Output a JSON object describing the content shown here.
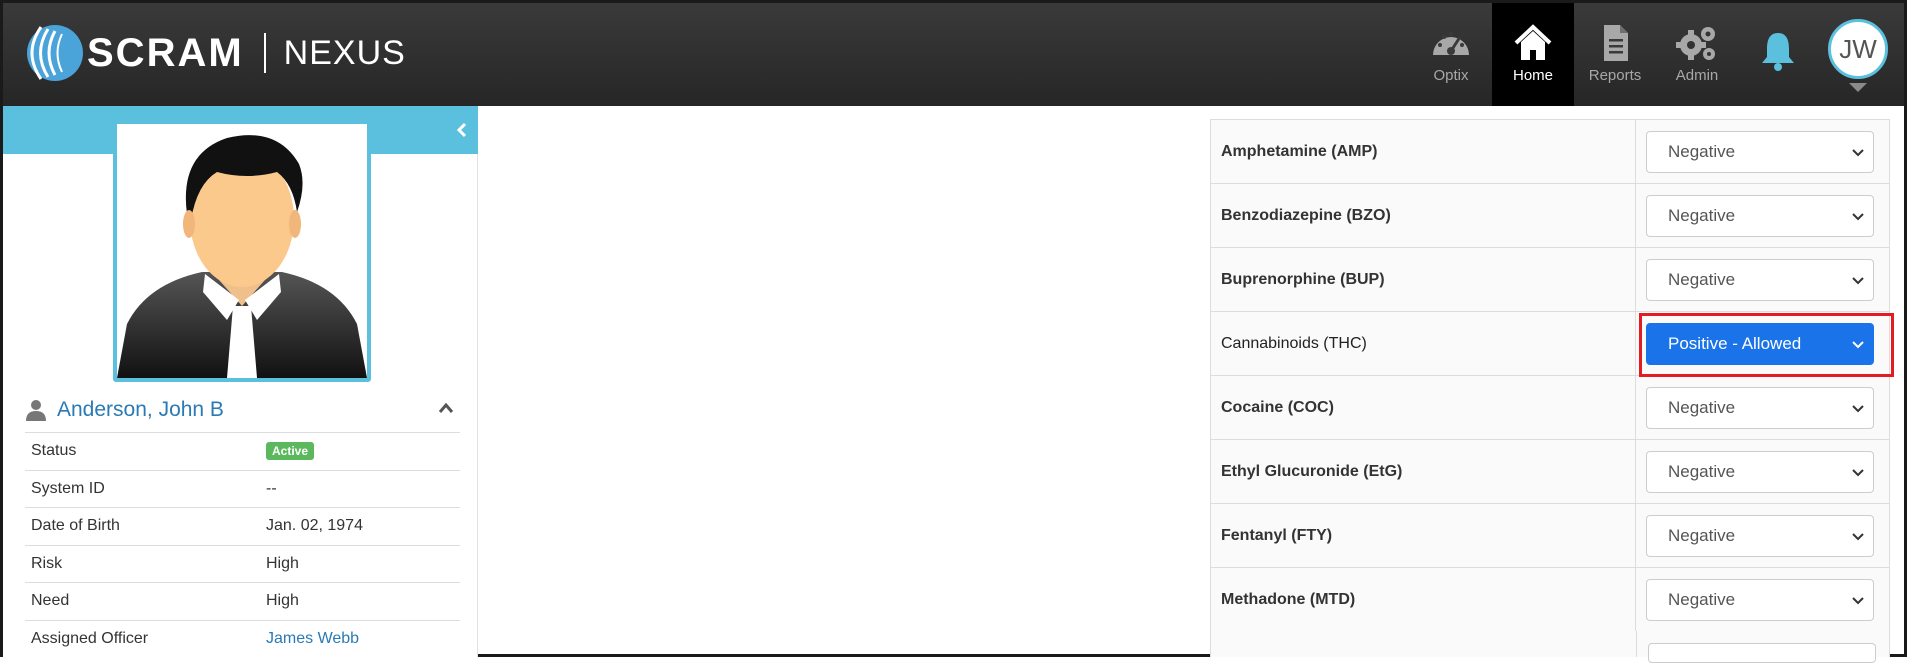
{
  "brand": {
    "name": "SCRAM",
    "product": "NEXUS"
  },
  "nav": {
    "items": [
      {
        "label": "Optix",
        "icon": "speedometer-icon"
      },
      {
        "label": "Home",
        "icon": "home-icon"
      },
      {
        "label": "Reports",
        "icon": "document-icon"
      },
      {
        "label": "Admin",
        "icon": "gears-icon"
      }
    ],
    "active": "Home",
    "user_initials": "JW"
  },
  "colors": {
    "accent": "#5bc0de",
    "link": "#2a7ab5",
    "selected": "#1a73e8",
    "highlight_border": "#e31b23",
    "active_badge": "#5cb85c"
  },
  "participant": {
    "name": "Anderson, John B",
    "fields": [
      {
        "label": "Status",
        "value": "Active"
      },
      {
        "label": "System ID",
        "value": "--"
      },
      {
        "label": "Date of Birth",
        "value": "Jan. 02, 1974"
      },
      {
        "label": "Risk",
        "value": "High"
      },
      {
        "label": "Need",
        "value": "High"
      },
      {
        "label": "Assigned Officer",
        "value": "James Webb"
      }
    ]
  },
  "drug_results": [
    {
      "drug": "Amphetamine (AMP)",
      "result": "Negative"
    },
    {
      "drug": "Benzodiazepine (BZO)",
      "result": "Negative"
    },
    {
      "drug": "Buprenorphine (BUP)",
      "result": "Negative"
    },
    {
      "drug": "Cannabinoids (THC)",
      "result": "Positive - Allowed"
    },
    {
      "drug": "Cocaine (COC)",
      "result": "Negative"
    },
    {
      "drug": "Ethyl Glucuronide (EtG)",
      "result": "Negative"
    },
    {
      "drug": "Fentanyl (FTY)",
      "result": "Negative"
    },
    {
      "drug": "Methadone (MTD)",
      "result": "Negative"
    }
  ]
}
